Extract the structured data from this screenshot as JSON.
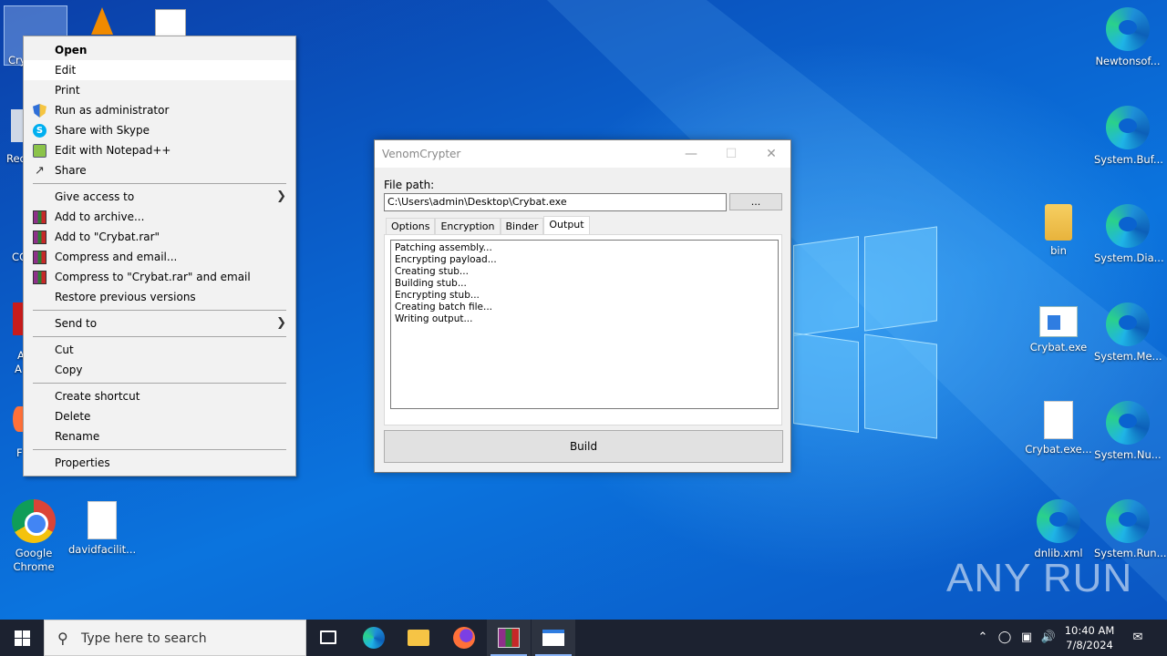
{
  "desktop": {
    "left_icons": [
      {
        "label": "Google Chrome",
        "icon": "chrome-icon"
      },
      {
        "label": "davidfacilit...",
        "icon": "document-icon"
      }
    ],
    "right_icons": [
      {
        "label": "Newtonsof...",
        "icon": "edge-icon"
      },
      {
        "label": "System.Buf...",
        "icon": "edge-icon"
      },
      {
        "label": "bin",
        "icon": "folder-icon"
      },
      {
        "label": "System.Dia...",
        "icon": "edge-icon"
      },
      {
        "label": "Crybat.exe",
        "icon": "exe-icon"
      },
      {
        "label": "System.Me...",
        "icon": "edge-icon"
      },
      {
        "label": "Crybat.exe...",
        "icon": "blank-file-icon"
      },
      {
        "label": "System.Nu...",
        "icon": "edge-icon"
      },
      {
        "label": "dnlib.xml",
        "icon": "edge-icon"
      },
      {
        "label": "System.Run...",
        "icon": "edge-icon"
      }
    ],
    "partial_labels": [
      "Cry",
      "Rec",
      "CC",
      "A",
      "A",
      "F"
    ]
  },
  "context_menu": {
    "items": [
      {
        "label": "Open"
      },
      {
        "label": "Edit"
      },
      {
        "label": "Print"
      },
      {
        "label": "Run as administrator"
      },
      {
        "label": "Share with Skype"
      },
      {
        "label": "Edit with Notepad++"
      },
      {
        "label": "Share"
      },
      {
        "label": "Give access to"
      },
      {
        "label": "Add to archive..."
      },
      {
        "label": "Add to \"Crybat.rar\""
      },
      {
        "label": "Compress and email..."
      },
      {
        "label": "Compress to \"Crybat.rar\" and email"
      },
      {
        "label": "Restore previous versions"
      },
      {
        "label": "Send to"
      },
      {
        "label": "Cut"
      },
      {
        "label": "Copy"
      },
      {
        "label": "Create shortcut"
      },
      {
        "label": "Delete"
      },
      {
        "label": "Rename"
      },
      {
        "label": "Properties"
      }
    ]
  },
  "app": {
    "title": "VenomCrypter",
    "file_path_label": "File path:",
    "file_path_value": "C:\\Users\\admin\\Desktop\\Crybat.exe",
    "browse_label": "...",
    "tabs": [
      "Options",
      "Encryption",
      "Binder",
      "Output"
    ],
    "active_tab": "Output",
    "output_lines": [
      "Patching assembly...",
      "Encrypting payload...",
      "Creating stub...",
      "Building stub...",
      "Encrypting stub...",
      "Creating batch file...",
      "Writing output..."
    ],
    "build_label": "Build"
  },
  "taskbar": {
    "search_placeholder": "Type here to search",
    "time": "10:40 AM",
    "date": "7/8/2024"
  },
  "watermark": "ANY RUN"
}
